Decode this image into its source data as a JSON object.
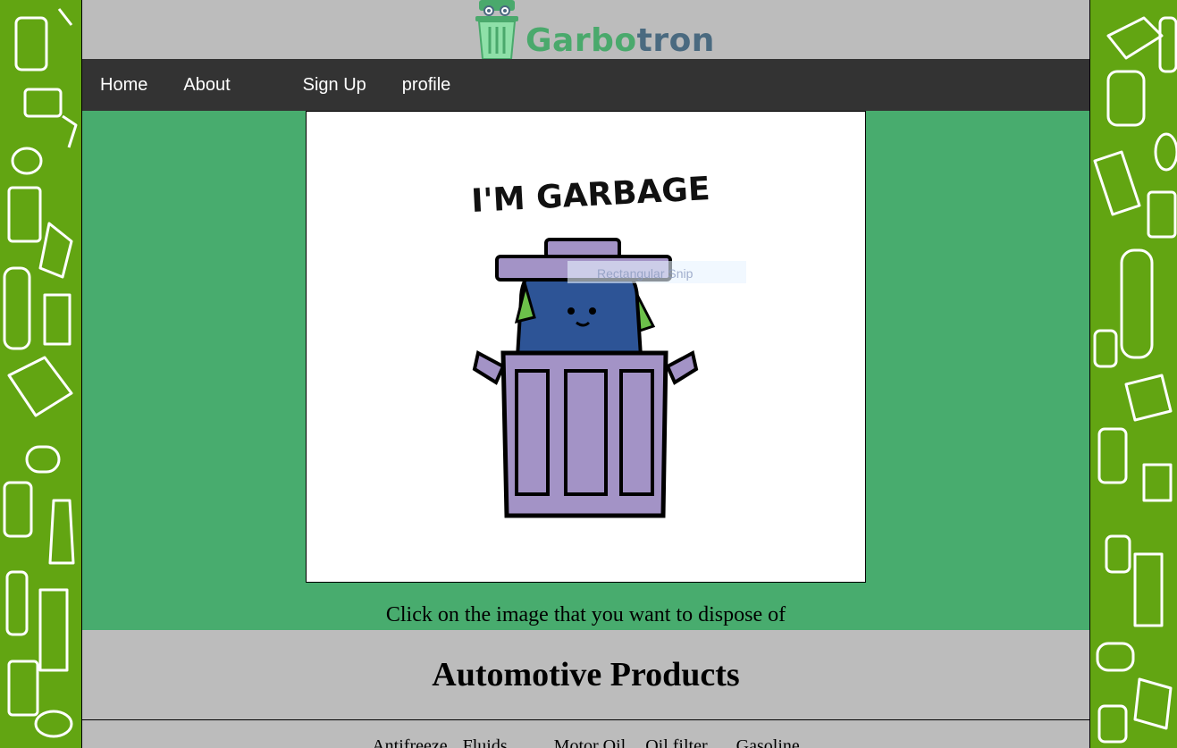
{
  "brand": {
    "logo_word_left": "Garbo",
    "logo_word_right": "tron",
    "icon": "trash-can-robot-icon"
  },
  "nav": {
    "items": [
      {
        "label": "Home"
      },
      {
        "label": "About"
      },
      {
        "label": "Sign Up"
      },
      {
        "label": "profile"
      }
    ]
  },
  "hero": {
    "image_text": "I'M GARBAGE",
    "overlay_text": "Rectangular Snip",
    "caption": "Click on the image that you want to dispose of"
  },
  "section": {
    "title": "Automotive Products",
    "items": [
      "Antifreeze",
      "Fluids",
      "Motor Oil",
      "Oil filter",
      "Gasoline"
    ]
  },
  "colors": {
    "side_pattern": "#62a512",
    "page_bg": "#bcbcbc",
    "nav_bg": "#333333",
    "hero_bg": "#48ac6e",
    "trash_can": "#a393c6",
    "monster": "#2d5496"
  }
}
